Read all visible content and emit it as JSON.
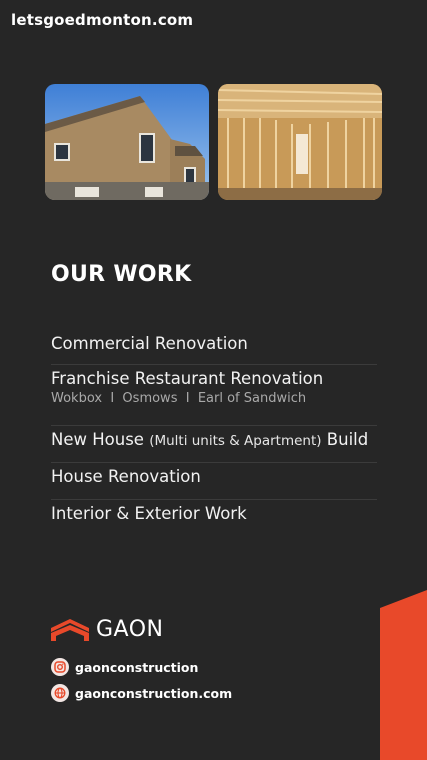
{
  "watermark": "letsgoedmonton.com",
  "photos": [
    {
      "alt": "house-exterior-photo"
    },
    {
      "alt": "wood-framing-photo"
    }
  ],
  "section_title": "OUR WORK",
  "work_items": [
    {
      "label": "Commercial Renovation"
    },
    {
      "label": "Franchise Restaurant Renovation",
      "sub": "Wokbox  I  Osmows  I  Earl of Sandwich"
    },
    {
      "label_pre": "New House ",
      "label_paren": "(Multi units & Apartment)",
      "label_post": " Build"
    },
    {
      "label": "House Renovation"
    },
    {
      "label": "Interior & Exterior Work"
    }
  ],
  "logo_text": "GAON",
  "contacts": {
    "instagram": "gaonconstruction",
    "website": "gaonconstruction.com"
  },
  "colors": {
    "background": "#262626",
    "accent": "#e8492a"
  }
}
